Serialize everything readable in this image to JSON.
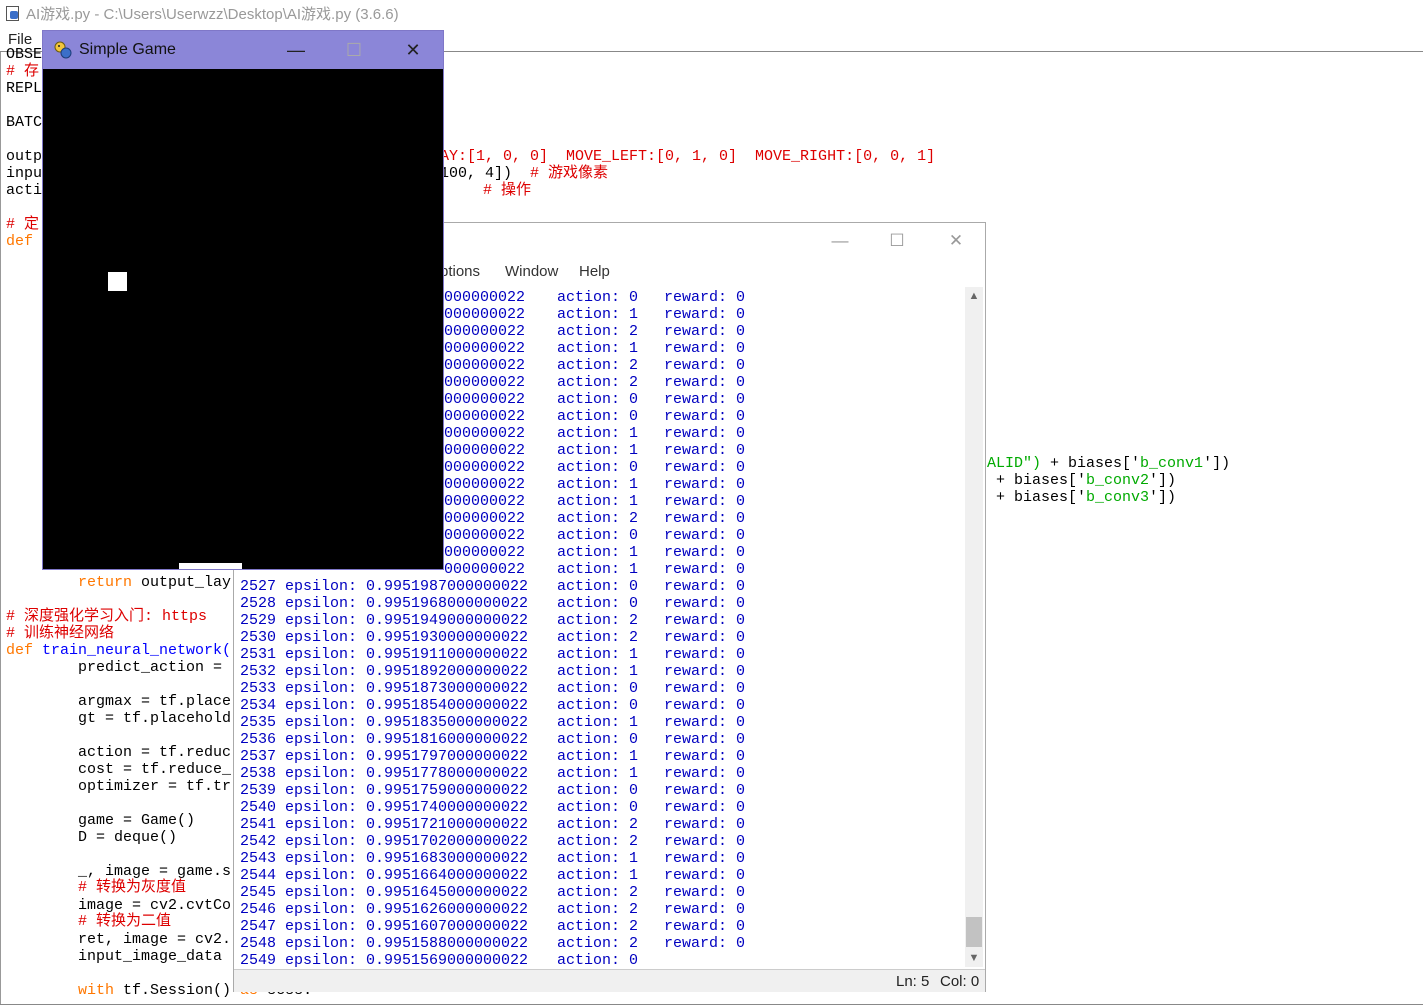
{
  "editor": {
    "title": "AI游戏.py - C:\\Users\\Userwzz\\Desktop\\AI游戏.py (3.6.6)",
    "menu": [
      "File"
    ],
    "code_left": [
      {
        "text": "OBSE",
        "cls": ""
      },
      {
        "text": "# 存",
        "cls": "cmt"
      },
      {
        "text": "REPL",
        "cls": ""
      },
      {
        "text": "",
        "cls": ""
      },
      {
        "text": "BATC",
        "cls": ""
      },
      {
        "text": "",
        "cls": ""
      },
      {
        "text": "outp",
        "cls": ""
      },
      {
        "text": "inpu",
        "cls": ""
      },
      {
        "text": "acti",
        "cls": ""
      },
      {
        "text": "",
        "cls": ""
      },
      {
        "text": "# 定",
        "cls": "cmt"
      },
      {
        "text": "def",
        "cls": "kw"
      }
    ],
    "code_right_top": {
      "line1": "AY:[1, 0, 0]  MOVE_LEFT:[0, 1, 0]  MOVE_RIGHT:[0, 0, 1]",
      "line2a": "100, 4])  ",
      "line2b": "# 游戏像素",
      "line3": "# 操作",
      "line4": "                      "
    },
    "code_right_mid": {
      "line1a": "ALID\")",
      "line1b": " + biases['",
      "line1c": "b_conv1",
      "line1d": "'])",
      "line2a": " + biases['",
      "line2b": "b_conv2",
      "line2c": "'])",
      "line3a": " + biases['",
      "line3b": "b_conv3",
      "line3c": "'])"
    },
    "code_bottom": {
      "return_kw": "return",
      "return_rest": " output_lay",
      "c1": "# 深度强化学习入门: https",
      "c2": "# 训练神经网络",
      "def_kw": "def",
      "def_name": " train_neural_network(",
      "l_predict": "predict_action = ",
      "l_argmax": "argmax = tf.place",
      "l_gt": "gt = tf.placehold",
      "l_action": "action = tf.reduc",
      "l_cost": "cost = tf.reduce_",
      "l_optimizer": "optimizer = tf.tr",
      "l_game": "game = Game()",
      "l_D": "D = deque()",
      "l_image": "_, image = game.s",
      "c3": "# 转换为灰度值",
      "l_cvt": "image = cv2.cvtCo",
      "c4": "# 转换为二值",
      "l_ret": "ret, image = cv2.",
      "l_input": "input_image_data ",
      "with_kw": "with",
      "with_rest": " tf.Session() ",
      "as_kw": "as",
      "as_rest": " sess:"
    }
  },
  "shell": {
    "menu": [
      "ptions",
      "Window",
      "Help"
    ],
    "status": {
      "ln": "Ln: 5",
      "col": "Col: 0"
    },
    "rows_partial": [
      {
        "eps": "000000022",
        "action": "0",
        "reward": "0"
      },
      {
        "eps": "000000022",
        "action": "1",
        "reward": "0"
      },
      {
        "eps": "000000022",
        "action": "2",
        "reward": "0"
      },
      {
        "eps": "000000022",
        "action": "1",
        "reward": "0"
      },
      {
        "eps": "000000022",
        "action": "2",
        "reward": "0"
      },
      {
        "eps": "000000022",
        "action": "2",
        "reward": "0"
      },
      {
        "eps": "000000022",
        "action": "0",
        "reward": "0"
      },
      {
        "eps": "000000022",
        "action": "0",
        "reward": "0"
      },
      {
        "eps": "000000022",
        "action": "1",
        "reward": "0"
      },
      {
        "eps": "000000022",
        "action": "1",
        "reward": "0"
      },
      {
        "eps": "000000022",
        "action": "0",
        "reward": "0"
      },
      {
        "eps": "000000022",
        "action": "1",
        "reward": "0"
      },
      {
        "eps": "000000022",
        "action": "1",
        "reward": "0"
      },
      {
        "eps": "000000022",
        "action": "2",
        "reward": "0"
      },
      {
        "eps": "000000022",
        "action": "0",
        "reward": "0"
      },
      {
        "eps": "000000022",
        "action": "1",
        "reward": "0"
      },
      {
        "eps": "000000022",
        "action": "1",
        "reward": "0"
      }
    ],
    "rows_full": [
      {
        "step": "2527",
        "eps": "0.9951987000000022",
        "action": "0",
        "reward": "0"
      },
      {
        "step": "2528",
        "eps": "0.9951968000000022",
        "action": "0",
        "reward": "0"
      },
      {
        "step": "2529",
        "eps": "0.9951949000000022",
        "action": "2",
        "reward": "0"
      },
      {
        "step": "2530",
        "eps": "0.9951930000000022",
        "action": "2",
        "reward": "0"
      },
      {
        "step": "2531",
        "eps": "0.9951911000000022",
        "action": "1",
        "reward": "0"
      },
      {
        "step": "2532",
        "eps": "0.9951892000000022",
        "action": "1",
        "reward": "0"
      },
      {
        "step": "2533",
        "eps": "0.9951873000000022",
        "action": "0",
        "reward": "0"
      },
      {
        "step": "2534",
        "eps": "0.9951854000000022",
        "action": "0",
        "reward": "0"
      },
      {
        "step": "2535",
        "eps": "0.9951835000000022",
        "action": "1",
        "reward": "0"
      },
      {
        "step": "2536",
        "eps": "0.9951816000000022",
        "action": "0",
        "reward": "0"
      },
      {
        "step": "2537",
        "eps": "0.9951797000000022",
        "action": "1",
        "reward": "0"
      },
      {
        "step": "2538",
        "eps": "0.9951778000000022",
        "action": "1",
        "reward": "0"
      },
      {
        "step": "2539",
        "eps": "0.9951759000000022",
        "action": "0",
        "reward": "0"
      },
      {
        "step": "2540",
        "eps": "0.9951740000000022",
        "action": "0",
        "reward": "0"
      },
      {
        "step": "2541",
        "eps": "0.9951721000000022",
        "action": "2",
        "reward": "0"
      },
      {
        "step": "2542",
        "eps": "0.9951702000000022",
        "action": "2",
        "reward": "0"
      },
      {
        "step": "2543",
        "eps": "0.9951683000000022",
        "action": "1",
        "reward": "0"
      },
      {
        "step": "2544",
        "eps": "0.9951664000000022",
        "action": "1",
        "reward": "0"
      },
      {
        "step": "2545",
        "eps": "0.9951645000000022",
        "action": "2",
        "reward": "0"
      },
      {
        "step": "2546",
        "eps": "0.9951626000000022",
        "action": "2",
        "reward": "0"
      },
      {
        "step": "2547",
        "eps": "0.9951607000000022",
        "action": "2",
        "reward": "0"
      },
      {
        "step": "2548",
        "eps": "0.9951588000000022",
        "action": "2",
        "reward": "0"
      },
      {
        "step": "2549",
        "eps": "0.9951569000000022",
        "action": "0",
        "reward": ""
      }
    ],
    "labels": {
      "epsilon": "epsilon:",
      "action": "action:",
      "reward": "reward:"
    }
  },
  "game": {
    "title": "Simple Game",
    "colors": {
      "titlebar": "#8b86d8",
      "canvas": "#000000",
      "sprite": "#ffffff"
    }
  }
}
